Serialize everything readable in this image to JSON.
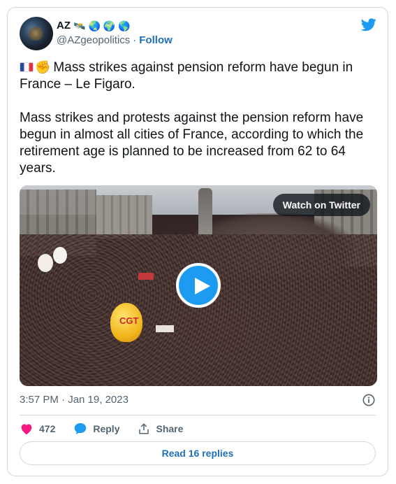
{
  "author": {
    "display_name": "AZ",
    "name_emojis": [
      "🛰️",
      "🌏",
      "🌍",
      "🌎"
    ],
    "handle": "@AZgeopolitics",
    "separator": "·",
    "follow_label": "Follow"
  },
  "tweet": {
    "line1_emoji": [
      "🇫🇷",
      "✊"
    ],
    "text": "Mass strikes against pension reform have begun in France – Le Figaro.\n\nMass strikes and protests against the pension reform have begun in almost all cities of France, according to which the retirement age is planned to be increased from 62 to 64 years.",
    "media": {
      "watch_label": "Watch on Twitter",
      "balloon_text": "CGT"
    },
    "timestamp": "3:57 PM · Jan 19, 2023"
  },
  "actions": {
    "likes_count": "472",
    "reply_label": "Reply",
    "share_label": "Share",
    "read_replies_label": "Read 16 replies"
  },
  "colors": {
    "twitter_blue": "#1d9bf0",
    "like_pink": "#f91880",
    "link_blue": "#1d6fb8",
    "muted": "#536471",
    "border": "#cfd9de"
  }
}
